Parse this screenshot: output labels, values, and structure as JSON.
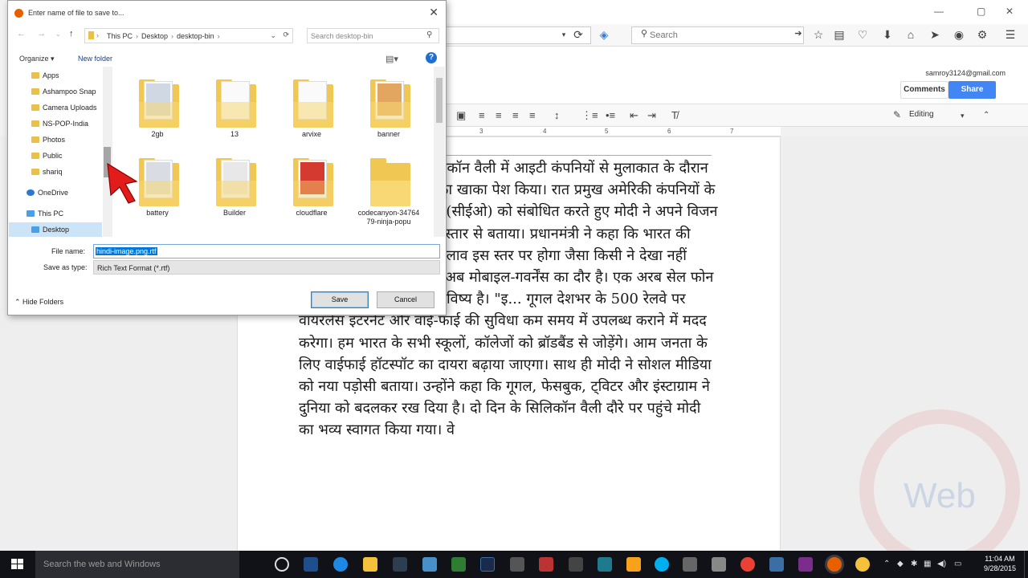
{
  "browser": {
    "search_placeholder": "Search",
    "window_min": "—",
    "window_max": "▢",
    "window_close": "✕"
  },
  "docs": {
    "user_email": "samroy3124@gmail.com",
    "comments_label": "Comments",
    "share_label": "Share",
    "editing_label": "Editing",
    "ruler_marks": [
      "3",
      "4",
      "5",
      "6",
      "7"
    ],
    "body_text": "प्रधानमंत्री नरेंद्र मोदी ने सिलिकॉन वैली में आइटी कंपनियों से मुलाकात के दौरान डिजिटल इंडिया के भविष्य का खाका पेश किया। रात प्रमुख अमेरिकी कंपनियों के मुख्य कार्यकारी अधिकारियों (सीईओ) को संबोधित करते हुए मोदी ने अपने विजन डिजिटल इंडिया के बारे में विस्तार से बताया। प्रधानमंत्री ने कहा कि भारत की तस्वीर बदल जाएगी। यह बदलाव इस स्तर पर होगा जैसा किसी ने देखा नहीं होगा। प्रधानमंत्री ने कहा कि अब मोबाइल-गवर्नेंस का दौर है। एक अरब सेल फोन वाले देश में एम-गवर्नेंस ही भविष्य है। \"इ... गूगल देशभर के 500 रेलवे पर वायरलेस इंटरनेट और वाई-फाई की सुविधा कम समय में उपलब्ध कराने में मदद करेगा। हम भारत के सभी स्कूलों, कॉलेजों को ब्रॉडबैंड से जोड़ेंगे। आम जनता के लिए वाईफाई हॉटस्पॉट का दायरा बढ़ाया जाएगा। साथ ही मोदी ने सोशल मीडिया को नया पड़ोसी बताया। उन्होंने कहा कि गूगल, फेसबुक, ट्विटर और इंस्टाग्राम ने दुनिया को बदलकर रख दिया है। दो दिन के सिलिकॉन वैली दौरे पर पहुंचे मोदी का भव्य स्वागत किया गया। वे",
    "watermark": "Web"
  },
  "dialog": {
    "title": "Enter name of file to save to...",
    "path": [
      "This PC",
      "Desktop",
      "desktop-bin"
    ],
    "search_placeholder": "Search desktop-bin",
    "organize_label": "Organize ▾",
    "new_folder_label": "New folder",
    "nav_items": [
      {
        "label": "Apps",
        "icon": "folder-icon"
      },
      {
        "label": "Ashampoo Snap",
        "icon": "folder-icon"
      },
      {
        "label": "Camera Uploads",
        "icon": "folder-icon"
      },
      {
        "label": "NS-POP-India",
        "icon": "folder-icon"
      },
      {
        "label": "Photos",
        "icon": "folder-icon"
      },
      {
        "label": "Public",
        "icon": "folder-icon"
      },
      {
        "label": "shariq",
        "icon": "folder-icon"
      },
      {
        "label": "OneDrive",
        "icon": "cloud-icon"
      },
      {
        "label": "This PC",
        "icon": "computer-icon"
      },
      {
        "label": "Desktop",
        "icon": "folder-icon"
      }
    ],
    "files": [
      {
        "label": "2gb",
        "pic": "#cfd8e3"
      },
      {
        "label": "13",
        "pic": "#f2f2f2"
      },
      {
        "label": "arvixe",
        "pic": "#f2f2f2"
      },
      {
        "label": "banner",
        "pic": "#e2a660"
      },
      {
        "label": "battery",
        "pic": "#d9dde3"
      },
      {
        "label": "Builder",
        "pic": "#e8e8e8"
      },
      {
        "label": "cloudflare",
        "pic": "#d43a2f"
      },
      {
        "label": "codecanyon-3476479-ninja-popu",
        "pic": "#f2d27a"
      }
    ],
    "file_name_label": "File name:",
    "file_name_value": "hindi-image.png.rtf",
    "save_type_label": "Save as type:",
    "save_type_value": "Rich Text Format (*.rtf)",
    "hide_folders_label": "Hide Folders",
    "save_label": "Save",
    "cancel_label": "Cancel"
  },
  "taskbar": {
    "search_placeholder": "Search the web and Windows",
    "time": "11:04 AM",
    "date": "9/28/2015"
  }
}
